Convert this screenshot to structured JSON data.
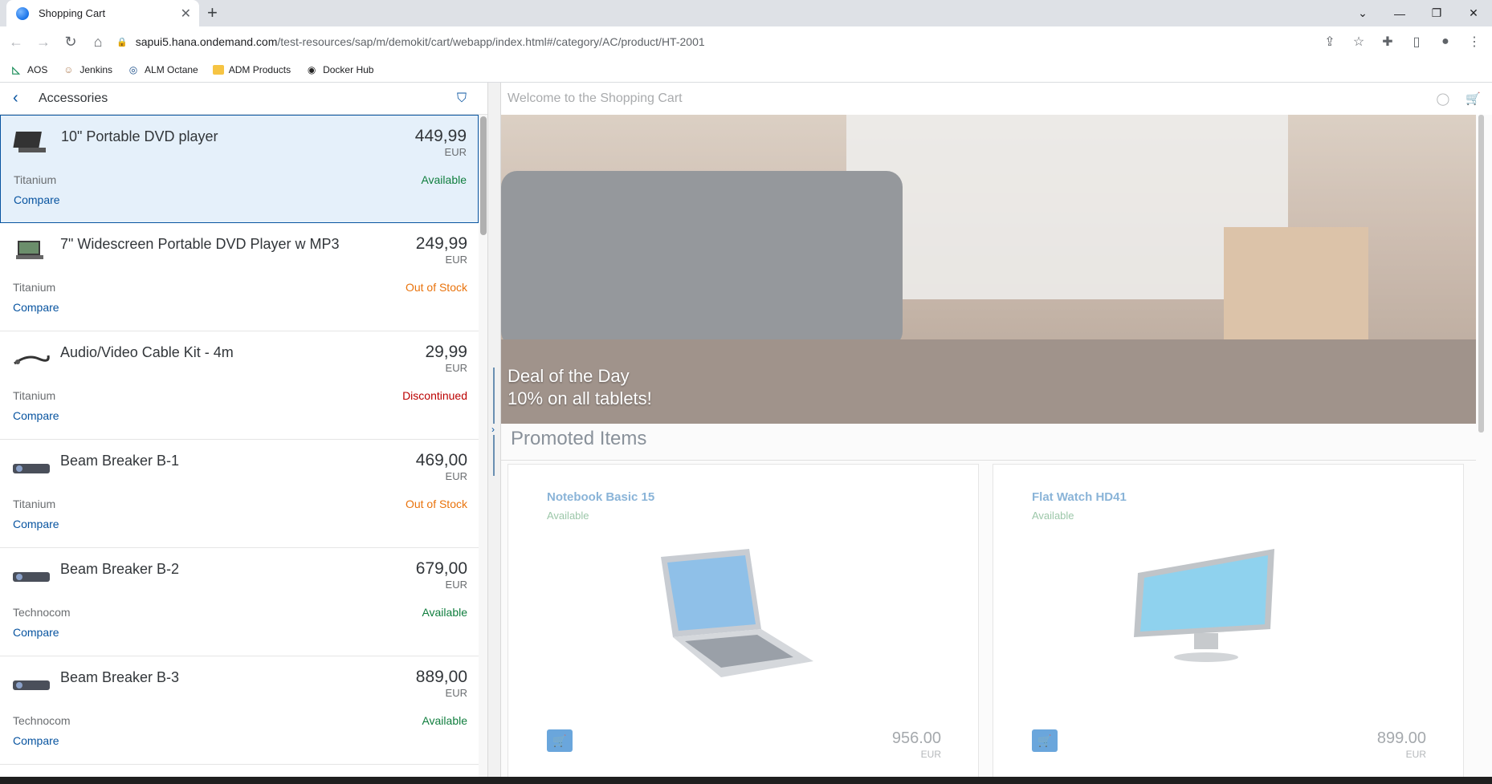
{
  "browser": {
    "tab_title": "Shopping Cart",
    "tab_close": "✕",
    "new_tab": "+",
    "url_host": "sapui5.hana.ondemand.com",
    "url_path": "/test-resources/sap/m/demokit/cart/webapp/index.html#/category/AC/product/HT-2001",
    "bookmarks": [
      {
        "label": "AOS",
        "icon": "aos-icon"
      },
      {
        "label": "Jenkins",
        "icon": "jenkins-icon"
      },
      {
        "label": "ALM Octane",
        "icon": "alm-octane-icon"
      },
      {
        "label": "ADM Products",
        "icon": "folder-icon"
      },
      {
        "label": "Docker Hub",
        "icon": "docker-hub-icon"
      }
    ]
  },
  "master": {
    "title": "Accessories",
    "compare_label": "Compare",
    "items": [
      {
        "name": "10\" Portable DVD player",
        "price": "449,99",
        "currency": "EUR",
        "supplier": "Titanium",
        "status": "Available",
        "status_type": "available"
      },
      {
        "name": "7\" Widescreen Portable DVD Player w MP3",
        "price": "249,99",
        "currency": "EUR",
        "supplier": "Titanium",
        "status": "Out of Stock",
        "status_type": "out"
      },
      {
        "name": "Audio/Video Cable Kit - 4m",
        "price": "29,99",
        "currency": "EUR",
        "supplier": "Titanium",
        "status": "Discontinued",
        "status_type": "disc"
      },
      {
        "name": "Beam Breaker B-1",
        "price": "469,00",
        "currency": "EUR",
        "supplier": "Titanium",
        "status": "Out of Stock",
        "status_type": "out"
      },
      {
        "name": "Beam Breaker B-2",
        "price": "679,00",
        "currency": "EUR",
        "supplier": "Technocom",
        "status": "Available",
        "status_type": "available"
      },
      {
        "name": "Beam Breaker B-3",
        "price": "889,00",
        "currency": "EUR",
        "supplier": "Technocom",
        "status": "Available",
        "status_type": "available"
      }
    ]
  },
  "detail": {
    "header_title": "Welcome to the Shopping Cart",
    "hero_line1": "Deal of the Day",
    "hero_line2": "10% on all tablets!",
    "promoted_title": "Promoted Items",
    "cards": [
      {
        "title": "Notebook Basic 15",
        "status": "Available",
        "price": "956.00",
        "currency": "EUR"
      },
      {
        "title": "Flat Watch HD41",
        "status": "Available",
        "price": "899.00",
        "currency": "EUR"
      }
    ]
  },
  "colors": {
    "accent": "#0854a0",
    "available": "#107e3e",
    "out_of_stock": "#e9730c",
    "discontinued": "#bb0000"
  }
}
